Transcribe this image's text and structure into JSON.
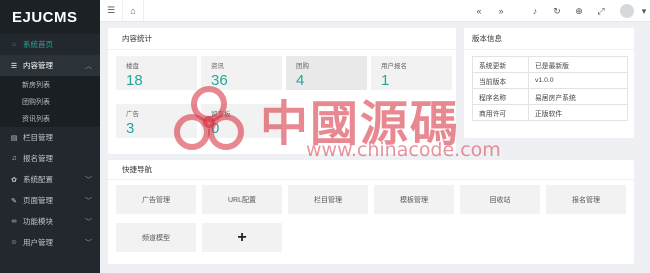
{
  "brand": {
    "logo": "EJUCMS"
  },
  "sidebar": {
    "items": [
      {
        "label": "系统首页",
        "icon": "home-icon"
      },
      {
        "label": "内容管理",
        "icon": "list-icon"
      },
      {
        "label": "栏目管理",
        "icon": "columns-icon"
      },
      {
        "label": "报名管理",
        "icon": "bell-icon"
      },
      {
        "label": "系统配置",
        "icon": "gear-icon"
      },
      {
        "label": "页面管理",
        "icon": "pencil-icon"
      },
      {
        "label": "功能模块",
        "icon": "link-icon"
      },
      {
        "label": "用户管理",
        "icon": "user-icon"
      }
    ],
    "subitems": [
      "新房列表",
      "团购列表",
      "资讯列表"
    ]
  },
  "content_stats": {
    "title": "内容统计",
    "cards": [
      {
        "label": "楼盘",
        "value": "18"
      },
      {
        "label": "资讯",
        "value": "36"
      },
      {
        "label": "团购",
        "value": "4"
      },
      {
        "label": "用户报名",
        "value": "1"
      },
      {
        "label": "广告",
        "value": "3"
      },
      {
        "label": "留言板",
        "value": "0"
      }
    ]
  },
  "version_info": {
    "title": "版本信息",
    "rows": [
      {
        "key": "系统更新",
        "value": "已是最新版"
      },
      {
        "key": "当前版本",
        "value": "v1.0.0"
      },
      {
        "key": "程序名称",
        "value": "易居房产系统"
      },
      {
        "key": "商用许可",
        "value": "正版软件"
      }
    ]
  },
  "quick_nav": {
    "title": "快捷导航",
    "buttons": [
      "广告管理",
      "URL配置",
      "栏目管理",
      "模板管理",
      "回收站",
      "报名管理",
      "频道模型"
    ],
    "add_label": "+"
  },
  "watermark": {
    "text": "中國源碼",
    "url": "www.chinacode.com"
  },
  "colors": {
    "accent": "#26a69a",
    "sidebar": "#22282e",
    "watermark": "#d62839"
  }
}
